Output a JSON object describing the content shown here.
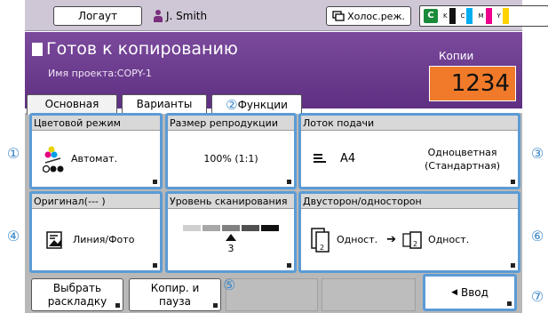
{
  "topbar": {
    "logout_label": "Логаут",
    "user_name": "J. Smith",
    "holos_label": "Холос.реж.",
    "ink": [
      {
        "name": "K",
        "color": "#111111"
      },
      {
        "name": "C",
        "color": "#00aeef"
      },
      {
        "name": "M",
        "color": "#ec008c"
      },
      {
        "name": "Y",
        "color": "#ffd200"
      }
    ]
  },
  "header": {
    "title": "Готов к копированию",
    "project": "Имя проекта:COPY-1",
    "copies_label": "Копии",
    "copies_value": "1234"
  },
  "tabs": {
    "main": "Основная",
    "variants": "Варианты",
    "functions": "Функции"
  },
  "cards": {
    "color_mode": {
      "title": "Цветовой режим",
      "value": "Автомат."
    },
    "repro_size": {
      "title": "Размер репродукции",
      "value": "100% (1:1)"
    },
    "tray": {
      "title": "Лоток подачи",
      "size": "A4",
      "paper_line1": "Одноцветная",
      "paper_line2": "(Стандартная)"
    },
    "original": {
      "title": "Оригинал(--- )",
      "value": "Линия/Фото"
    },
    "scan_level": {
      "title": "Уровень сканирования",
      "value": "3"
    },
    "duplex": {
      "title": "Двусторон/односторон",
      "from": "Одност.",
      "to": "Одност."
    }
  },
  "bottom": {
    "layout_line1": "Выбрать",
    "layout_line2": "раскладку",
    "pause_line1": "Копир. и",
    "pause_line2": "пауза",
    "enter_label": "Ввод"
  },
  "callouts": [
    "①",
    "②",
    "③",
    "④",
    "⑤",
    "⑥",
    "⑦"
  ],
  "colors": {
    "header_purple": "#6a3a8c",
    "copies_orange": "#f07a2a",
    "highlight_blue": "#5b9bd5"
  }
}
